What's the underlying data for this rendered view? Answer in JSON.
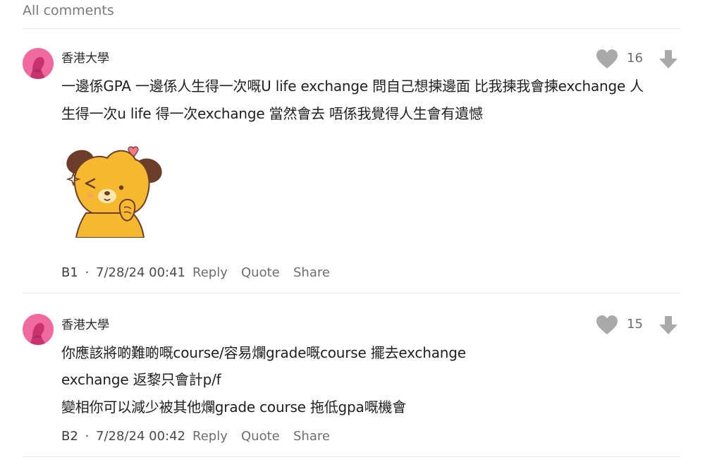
{
  "header": {
    "title": "All comments"
  },
  "comments": [
    {
      "author": "香港大學",
      "likes": "16",
      "lines": [
        "一邊係GPA 一邊係人生得一次嘅U life exchange 問自己想揀邊面 比我揀我會揀exchange 人",
        "生得一次u life 得一次exchange 當然會去 唔係我覺得人生會有遺憾"
      ],
      "has_sticker": true,
      "floor": "B1",
      "separator": "·",
      "timestamp": "7/28/24 00:41",
      "actions": {
        "reply": "Reply",
        "quote": "Quote",
        "share": "Share"
      }
    },
    {
      "author": "香港大學",
      "likes": "15",
      "lines": [
        "你應該將啲難啲嘅course/容易爛grade嘅course 擺去exchange",
        "exchange 返黎只會計p/f",
        "變相你可以減少被其他爛grade course 拖低gpa嘅機會"
      ],
      "has_sticker": false,
      "floor": "B2",
      "separator": "·",
      "timestamp": "7/28/24 00:42",
      "actions": {
        "reply": "Reply",
        "quote": "Quote",
        "share": "Share"
      }
    }
  ],
  "icons": {
    "avatar": "user-avatar-icon",
    "like": "heart-icon",
    "downvote": "arrow-down-icon",
    "sticker": "bear-sticker"
  },
  "colors": {
    "avatar_bg": "#f06aa0",
    "icon_gray": "#a9a9a9",
    "divider": "#e9e9e9",
    "sticker_yellow": "#f5b82e",
    "sticker_brown": "#6b3d2a"
  }
}
